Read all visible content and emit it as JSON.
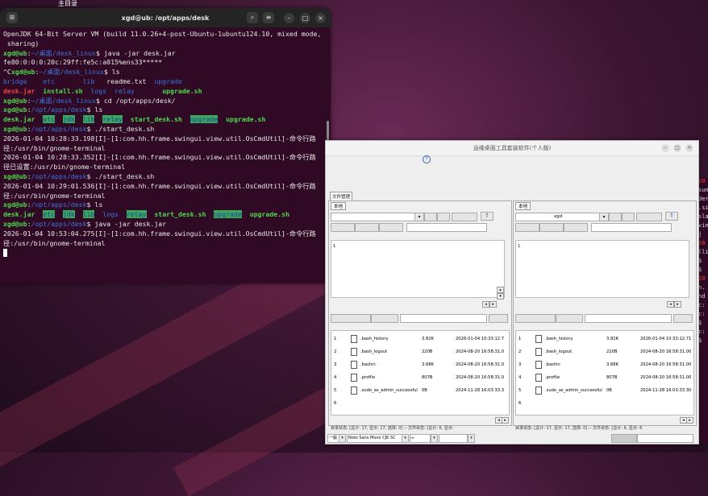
{
  "desktop": {
    "top_label": "主目录"
  },
  "terminal": {
    "title": "xgd@ub: /opt/apps/desk",
    "lines": [
      [
        [
          "t",
          "OpenJDK 64-Bit Server VM (build 11.0.26+4-post-Ubuntu-1ubuntu124.10, mixed mode,"
        ]
      ],
      [
        [
          "t",
          " sharing)"
        ]
      ],
      [
        [
          "g",
          "xgd@ub"
        ],
        [
          "t",
          ":"
        ],
        [
          "b",
          "~/桌面/desk_linux"
        ],
        [
          "t",
          "$ java -jar desk.jar"
        ]
      ],
      [
        [
          "t",
          "fe80:0:0:0:20c:29ff:fe5c:a015%ens33*****"
        ]
      ],
      [
        [
          "t",
          "^C"
        ],
        [
          "g",
          "xgd@ub"
        ],
        [
          "t",
          ":"
        ],
        [
          "b",
          "~/桌面/desk_linux"
        ],
        [
          "t",
          "$ ls"
        ]
      ],
      [
        [
          "b",
          "bridge    etc       lib   "
        ],
        [
          "t",
          "readme.txt  "
        ],
        [
          "b",
          "upgrade"
        ]
      ],
      [
        [
          "r",
          "desk.jar"
        ],
        [
          "t",
          "  "
        ],
        [
          "g",
          "install.sh"
        ],
        [
          "t",
          "  "
        ],
        [
          "b",
          "logs  relay"
        ],
        [
          "t",
          "       "
        ],
        [
          "g",
          "upgrade.sh"
        ]
      ],
      [
        [
          "g",
          "xgd@ub"
        ],
        [
          "t",
          ":"
        ],
        [
          "b",
          "~/桌面/desk_linux"
        ],
        [
          "t",
          "$ cd /opt/apps/desk/"
        ]
      ],
      [
        [
          "g",
          "xgd@ub"
        ],
        [
          "t",
          ":"
        ],
        [
          "b",
          "/opt/apps/desk"
        ],
        [
          "t",
          "$ ls"
        ]
      ],
      [
        [
          "g",
          "desk.jar"
        ],
        [
          "t",
          "  "
        ],
        [
          "hl",
          "etc"
        ],
        [
          "t",
          "  "
        ],
        [
          "hl",
          "jdk"
        ],
        [
          "t",
          "  "
        ],
        [
          "hl",
          "lib"
        ],
        [
          "t",
          "  "
        ],
        [
          "hl",
          "relay"
        ],
        [
          "t",
          "  "
        ],
        [
          "g",
          "start_desk.sh"
        ],
        [
          "t",
          "  "
        ],
        [
          "hl",
          "upgrade"
        ],
        [
          "t",
          "  "
        ],
        [
          "g",
          "upgrade.sh"
        ]
      ],
      [
        [
          "g",
          "xgd@ub"
        ],
        [
          "t",
          ":"
        ],
        [
          "b",
          "/opt/apps/desk"
        ],
        [
          "t",
          "$ ./start_desk.sh"
        ]
      ],
      [
        [
          "t",
          "2026-01-04 10:28:33.198[I]-[1:com.hh.frame.swingui.view.util.OsCmdUtil]-命令行路"
        ]
      ],
      [
        [
          "t",
          "径:/usr/bin/gnome-terminal"
        ]
      ],
      [
        [
          "t",
          "2026-01-04 10:28:33.352[I]-[1:com.hh.frame.swingui.view.util.OsCmdUtil]-命令行路"
        ]
      ],
      [
        [
          "t",
          "径已设置:/usr/bin/gnome-terminal"
        ]
      ],
      [
        [
          "g",
          "xgd@ub"
        ],
        [
          "t",
          ":"
        ],
        [
          "b",
          "/opt/apps/desk"
        ],
        [
          "t",
          "$ ./start_desk.sh"
        ]
      ],
      [
        [
          "t",
          "2026-01-04 10:29:01.536[I]-[1:com.hh.frame.swingui.view.util.OsCmdUtil]-命令行路"
        ]
      ],
      [
        [
          "t",
          "径:/usr/bin/gnome-terminal"
        ]
      ],
      [
        [
          "g",
          "xgd@ub"
        ],
        [
          "t",
          ":"
        ],
        [
          "b",
          "/opt/apps/desk"
        ],
        [
          "t",
          "$ ls"
        ]
      ],
      [
        [
          "g",
          "desk.jar"
        ],
        [
          "t",
          "  "
        ],
        [
          "hl",
          "etc"
        ],
        [
          "t",
          "  "
        ],
        [
          "hl",
          "jdk"
        ],
        [
          "t",
          "  "
        ],
        [
          "hl",
          "lib"
        ],
        [
          "t",
          "  "
        ],
        [
          "b",
          "logs"
        ],
        [
          "t",
          "  "
        ],
        [
          "hl",
          "relay"
        ],
        [
          "t",
          "  "
        ],
        [
          "g",
          "start_desk.sh"
        ],
        [
          "t",
          "  "
        ],
        [
          "hl",
          "upgrade"
        ],
        [
          "t",
          "  "
        ],
        [
          "g",
          "upgrade.sh"
        ]
      ],
      [
        [
          "g",
          "xgd@ub"
        ],
        [
          "t",
          ":"
        ],
        [
          "b",
          "/opt/apps/desk"
        ],
        [
          "t",
          "$ java -jar desk.jar"
        ]
      ],
      [
        [
          "t",
          "2026-01-04 10:53:04.275[I]-[1:com.hh.frame.swingui.view.util.OsCmdUtil]-命令行路"
        ]
      ],
      [
        [
          "t",
          "径:/usr/bin/gnome-terminal"
        ]
      ]
    ]
  },
  "app": {
    "title": "运维桌面工具套装软件(个人版)",
    "help": "?",
    "tab_manager": "文件管理",
    "left": {
      "tab": "本地",
      "combo_value": "",
      "list_num": "1",
      "files": [
        {
          "n": "1",
          "name": ".bash_history",
          "size": "3.82K",
          "date": "2026-01-04 10:33:12.7"
        },
        {
          "n": "2",
          "name": ".bash_logout",
          "size": "220B",
          "date": "2024-08-20 16:58:31.0"
        },
        {
          "n": "3",
          "name": ".bashrc",
          "size": "3.68K",
          "date": "2024-08-20 16:58:31.0"
        },
        {
          "n": "4",
          "name": ".profile",
          "size": "807B",
          "date": "2024-08-20 16:58:31.0"
        },
        {
          "n": "5",
          "name": ".sudo_as_admin_successful",
          "size": "0B",
          "date": "2024-11-28 16:03:33.3"
        },
        {
          "n": "6",
          "name": "",
          "size": "",
          "date": ""
        }
      ],
      "status": "目录状态: [总计: 17, 显示: 17, 选择: 0] -- 文件状态: [总计: 6, 显示:"
    },
    "right": {
      "tab": "本地",
      "combo_value": "xgd",
      "list_num": "1",
      "files": [
        {
          "n": "1",
          "name": ".bash_history",
          "size": "3.82K",
          "date": "2026-01-04 10:33:12.71"
        },
        {
          "n": "2",
          "name": ".bash_logout",
          "size": "220B",
          "date": "2024-08-20 16:58:31.00"
        },
        {
          "n": "3",
          "name": ".bashrc",
          "size": "3.68K",
          "date": "2024-08-20 16:58:31.00"
        },
        {
          "n": "4",
          "name": ".profile",
          "size": "807B",
          "date": "2024-08-20 16:58:31.00"
        },
        {
          "n": "5",
          "name": ".sudo_as_admin_successful",
          "size": "0B",
          "date": "2024-11-28 16:03:33.30"
        },
        {
          "n": "6",
          "name": "",
          "size": "",
          "date": ""
        }
      ],
      "status": "目录状态: [总计: 17, 显示: 17, 选择: 0] -- 文件状态: [总计: 6, 显示: 6"
    },
    "bottom": {
      "mode": "一般",
      "font": "Noto Sans Mono CJK SC"
    }
  },
  "right_term_fragments": [
    "20",
    "sun",
    "der",
    ".si",
    "sla",
    "vin",
    "",
    "j",
    "",
    "20",
    "lli",
    "$",
    "$",
    "20",
    "n.",
    "nd",
    "c:",
    "c:",
    "$",
    "",
    "c:",
    "$"
  ]
}
